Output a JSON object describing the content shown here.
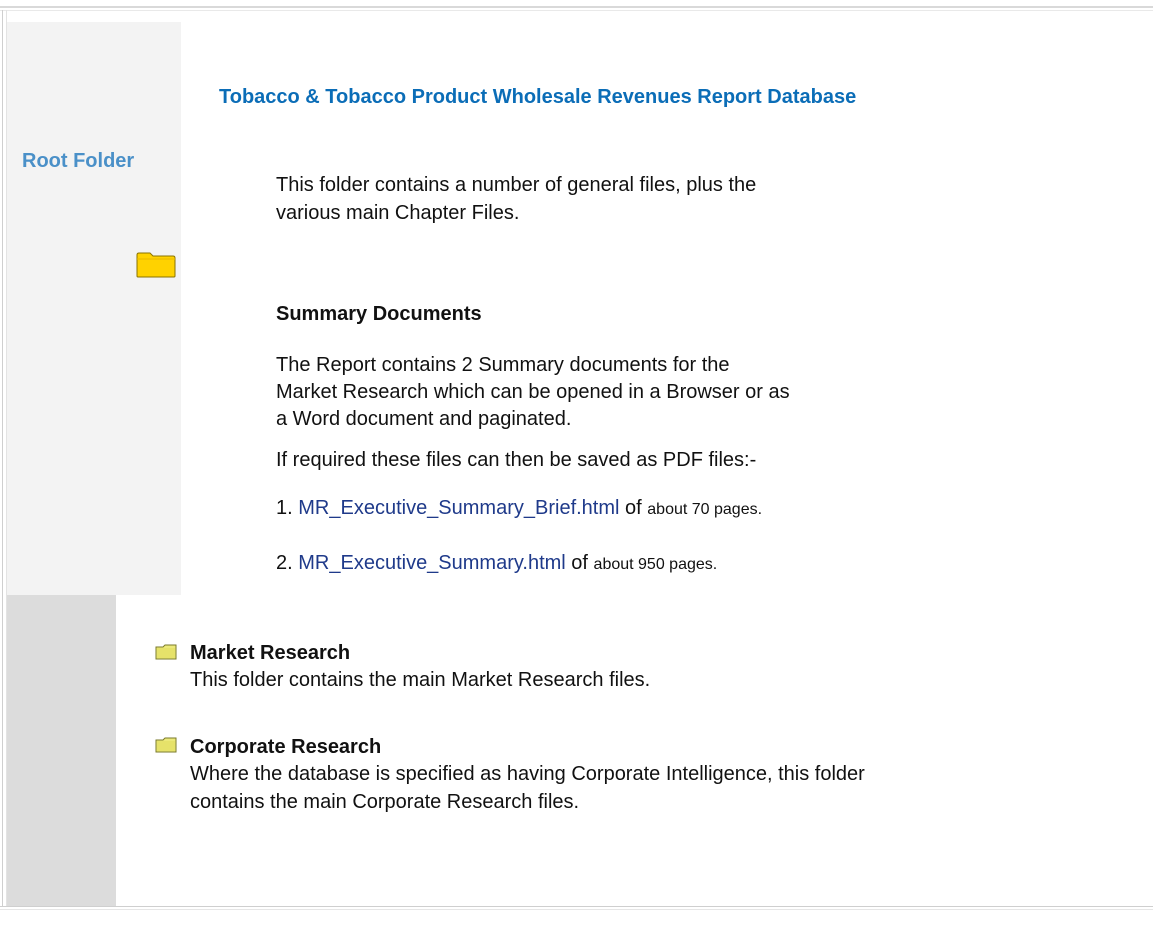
{
  "sidebar": {
    "root_label": "Root Folder"
  },
  "header": {
    "title": "Tobacco & Tobacco Product Wholesale Revenues Report Database"
  },
  "intro": {
    "text": "This folder contains a number of general files, plus the various main Chapter Files."
  },
  "summary": {
    "heading": "Summary Documents",
    "description": "The Report contains 2 Summary documents for the Market Research which can be opened in a Browser or as a Word document and paginated.",
    "pdf_note": "If required these files can then be saved as PDF files:-",
    "items": [
      {
        "number": "1.",
        "link": "MR_Executive_Summary_Brief.html",
        "of": "of",
        "pages": "about 70 pages."
      },
      {
        "number": "2.",
        "link": "MR_Executive_Summary.html",
        "of": "of",
        "pages": "about 950 pages."
      }
    ]
  },
  "folders": [
    {
      "title": "Market Research",
      "description": "This folder contains the main Market Research files."
    },
    {
      "title": "Corporate Research",
      "description": "Where the database is specified as having Corporate Intelligence, this folder contains the main Corporate Research files."
    }
  ],
  "colors": {
    "title": "#0b6db7",
    "root_label": "#4a90c8",
    "link": "#1f3a8a",
    "folder_fill": "#ffd200"
  }
}
